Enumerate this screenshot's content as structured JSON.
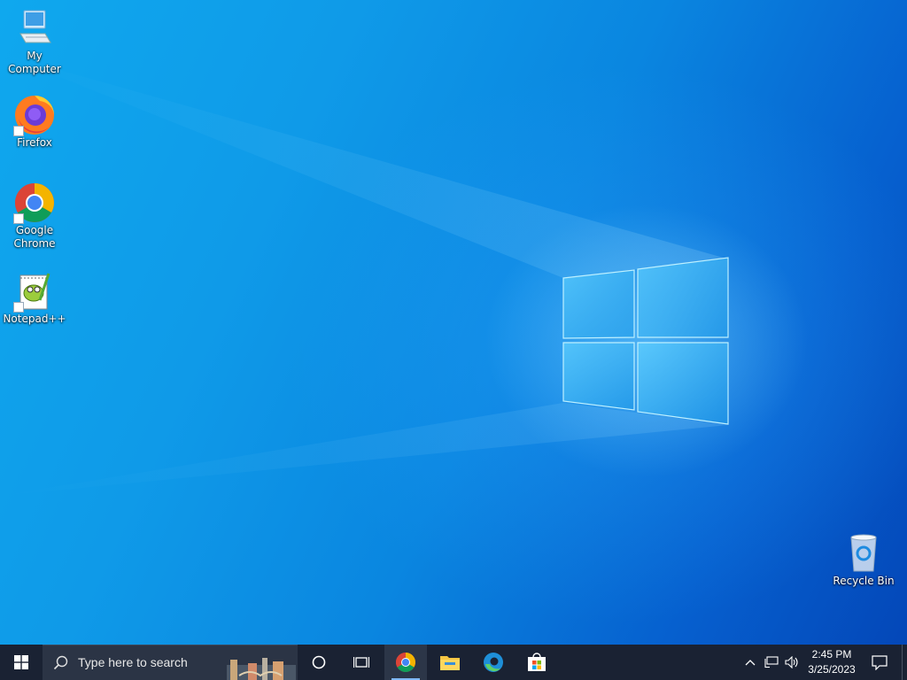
{
  "desktop": {
    "icons": [
      {
        "label": "My Computer",
        "icon": "computer-icon"
      },
      {
        "label": "Firefox",
        "icon": "firefox-icon"
      },
      {
        "label_line1": "Google",
        "label_line2": "Chrome",
        "icon": "chrome-icon"
      },
      {
        "label": "Notepad++",
        "icon": "notepadpp-icon"
      },
      {
        "label": "Recycle Bin",
        "icon": "recycle-bin-icon"
      }
    ]
  },
  "taskbar": {
    "start_icon": "windows-logo-icon",
    "search_placeholder": "Type here to search",
    "pinned": [
      {
        "name": "cortana",
        "icon": "cortana-circle-icon"
      },
      {
        "name": "task-view",
        "icon": "task-view-icon"
      },
      {
        "name": "chrome",
        "icon": "chrome-icon",
        "running": true
      },
      {
        "name": "file-explorer",
        "icon": "folder-icon"
      },
      {
        "name": "edge",
        "icon": "edge-icon"
      },
      {
        "name": "store",
        "icon": "store-icon"
      }
    ],
    "tray": {
      "time": "2:45 PM",
      "date": "3/25/2023"
    }
  },
  "colors": {
    "taskbar": "#1a2233",
    "wallpaper_accent": "#0a86e0"
  }
}
